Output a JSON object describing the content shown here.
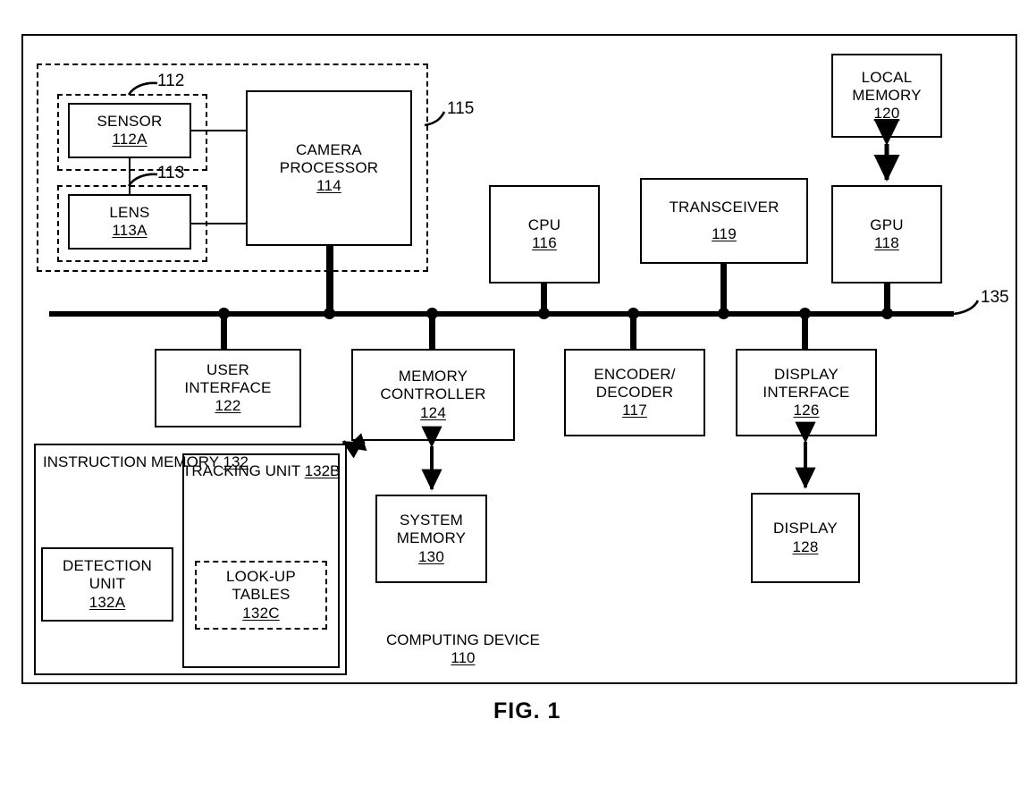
{
  "figure": {
    "caption": "FIG. 1",
    "outer_label": {
      "name": "COMPUTING DEVICE",
      "number": "110"
    }
  },
  "refs": {
    "camera_group": "112",
    "lens_group": "113",
    "camera_system": "115",
    "bus": "135"
  },
  "blocks": {
    "sensor": {
      "line1": "SENSOR",
      "number": "112A"
    },
    "lens": {
      "line1": "LENS",
      "number": "113A"
    },
    "camera_processor": {
      "line1": "CAMERA",
      "line2": "PROCESSOR",
      "number": "114"
    },
    "cpu": {
      "line1": "CPU",
      "number": "116"
    },
    "transceiver": {
      "line1": "TRANSCEIVER",
      "number": "119"
    },
    "local_memory": {
      "line1": "LOCAL",
      "line2": "MEMORY",
      "number": "120"
    },
    "gpu": {
      "line1": "GPU",
      "number": "118"
    },
    "user_interface": {
      "line1": "USER",
      "line2": "INTERFACE",
      "number": "122"
    },
    "memory_controller": {
      "line1": "MEMORY",
      "line2": "CONTROLLER",
      "number": "124"
    },
    "encoder_decoder": {
      "line1": "ENCODER/",
      "line2": "DECODER",
      "number": "117"
    },
    "display_interface": {
      "line1": "DISPLAY",
      "line2": "INTERFACE",
      "number": "126"
    },
    "system_memory": {
      "line1": "SYSTEM",
      "line2": "MEMORY",
      "number": "130"
    },
    "display": {
      "line1": "DISPLAY",
      "number": "128"
    },
    "instruction_memory": {
      "line1": "INSTRUCTION",
      "line2": "MEMORY",
      "number": "132"
    },
    "detection_unit": {
      "line1": "DETECTION",
      "line2": "UNIT",
      "number": "132A"
    },
    "tracking_unit": {
      "line1": "TRACKING",
      "line2": "UNIT",
      "number": "132B"
    },
    "lookup_tables": {
      "line1": "LOOK-UP",
      "line2": "TABLES",
      "number": "132C"
    }
  },
  "colors": {
    "stroke": "#000000",
    "background": "#ffffff"
  }
}
